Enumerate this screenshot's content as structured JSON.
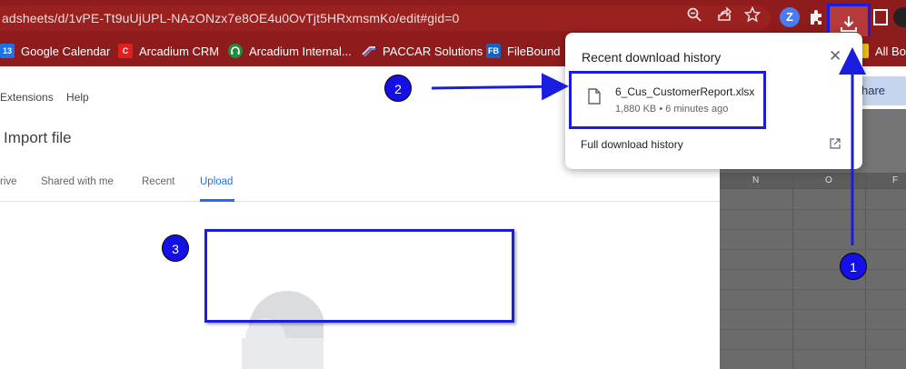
{
  "browser": {
    "url": "adsheets/d/1vPE-Tt9uUjUPL-NAzONzx7e8OE4u0OvTjt5HRxmsmKo/edit#gid=0",
    "extension_letter": "Z",
    "bookmarks": [
      {
        "label": "Google Calendar",
        "icon_text": "13",
        "color": "#1a73e8"
      },
      {
        "label": "Arcadium CRM",
        "icon_text": "C",
        "color": "#e02020"
      },
      {
        "label": "Arcadium Internal...",
        "icon_text": "",
        "color": "#1e8e3e"
      },
      {
        "label": "PACCAR Solutions",
        "icon_text": "",
        "color": "#2b3f8c"
      },
      {
        "label": "FileBound",
        "icon_text": "FB",
        "color": "#1565c0"
      },
      {
        "label": "All Boo",
        "icon_text": "",
        "color": "#f2c40f"
      }
    ]
  },
  "sheets": {
    "menu": [
      "Extensions",
      "Help"
    ],
    "share_label": "hare",
    "columns": [
      "N",
      "O",
      "F"
    ]
  },
  "import_dialog": {
    "title": "Import file",
    "tabs": [
      "rive",
      "Shared with me",
      "Recent",
      "Upload"
    ],
    "active_tab": "Upload"
  },
  "downloads_popup": {
    "title": "Recent download history",
    "close_glyph": "✕",
    "items": [
      {
        "filename": "6_Cus_CustomerReport.xlsx",
        "meta": "1,880 KB • 6 minutes ago"
      }
    ],
    "full_history_label": "Full download history"
  },
  "annotations": {
    "step1": "1",
    "step2": "2",
    "step3": "3",
    "color": "#1a1de0"
  }
}
